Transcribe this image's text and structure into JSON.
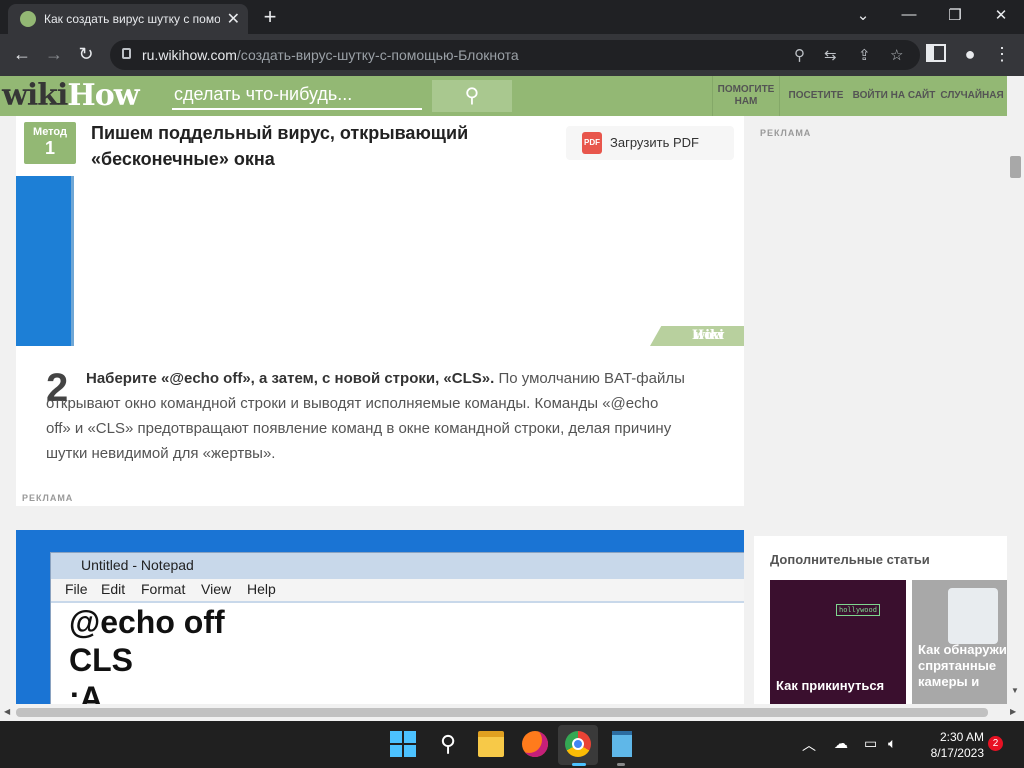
{
  "browser": {
    "tab_title": "Как создать вирус шутку с помощ",
    "url_domain": "ru.wikihow.com",
    "url_path": "/создать-вирус-шутку-с-помощью-Блокнота"
  },
  "header": {
    "logo_wiki": "wiki",
    "logo_how": "How",
    "search_placeholder": "сделать что-нибудь...",
    "nav": [
      "ПОМОГИТЕ НАМ",
      "ПОСЕТИТЕ",
      "ВОЙТИ НА САЙТ",
      "СЛУЧАЙНАЯ"
    ]
  },
  "method": {
    "label": "Метод",
    "number": "1",
    "title": "Пишем поддельный вирус, открывающий «бесконечные» окна",
    "pdf_button": "Загрузить PDF",
    "watermark_wiki": "wiki",
    "watermark_how": "How"
  },
  "step": {
    "number": "2",
    "bold": "Наберите «@echo off», а затем, с новой строки, «CLS».",
    "text": " По умолчанию BAT-файлы открывают окно командной строки и выводят исполняемые команды. Команды «@echo off» и «CLS» предотвращают появление команд в окне командной строки, делая причину шутки невидимой для «жертвы»."
  },
  "ads": {
    "label": "РЕКЛАМА"
  },
  "notepad": {
    "title": "Untitled - Notepad",
    "menu": [
      "File",
      "Edit",
      "Format",
      "View",
      "Help"
    ],
    "lines": [
      "@echo off",
      "CLS",
      ":A"
    ]
  },
  "sidebar": {
    "heading": "Дополнительные статьи",
    "thumb1_caption": "Как прикинуться",
    "thumb1_tag": "hollywood",
    "thumb2_caption": "Как обнаружить спрятанные камеры и"
  },
  "taskbar": {
    "time": "2:30 AM",
    "date": "8/17/2023",
    "badge": "2"
  },
  "colors": {
    "brand": "#93b874",
    "taskbar": "#202020"
  }
}
